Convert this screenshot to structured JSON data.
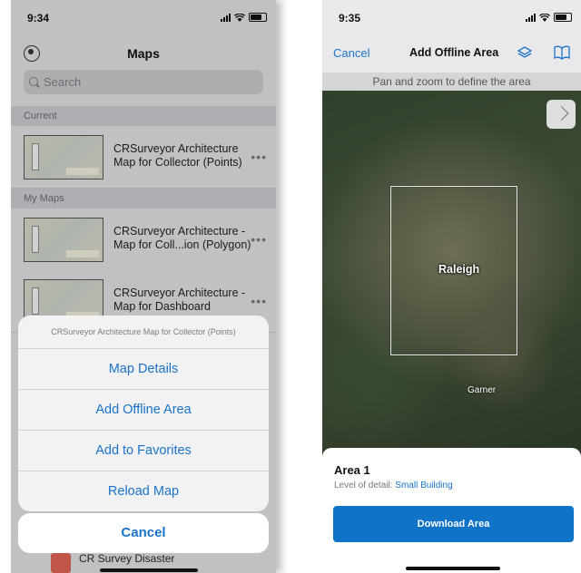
{
  "left": {
    "status": {
      "time": "9:34"
    },
    "title": "Maps",
    "search_placeholder": "Search",
    "sections": {
      "current": "Current",
      "my_maps": "My Maps"
    },
    "rows": [
      {
        "title": "CRSurveyor Architecture Map for Collector (Points)"
      },
      {
        "title": "CRSurveyor Architecture - Map for Coll...ion (Polygon)"
      },
      {
        "title": "CRSurveyor Architecture - Map for Dashboard"
      }
    ],
    "sheet": {
      "title": "CRSurveyor Architecture Map for Collector (Points)",
      "actions": [
        "Map Details",
        "Add Offline Area",
        "Add to Favorites",
        "Reload Map"
      ],
      "cancel": "Cancel"
    },
    "bottom_row": {
      "title": "CR Survey Disaster"
    }
  },
  "right": {
    "status": {
      "time": "9:35"
    },
    "nav": {
      "cancel": "Cancel",
      "title": "Add Offline Area"
    },
    "hint": "Pan and zoom to define the area",
    "map": {
      "city": "Raleigh",
      "town": "Garner"
    },
    "card": {
      "area_title": "Area 1",
      "detail_label": "Level of detail:",
      "detail_value": "Small Building",
      "button": "Download Area"
    }
  },
  "colors": {
    "accent": "#1a73c8",
    "button": "#0f73c7"
  }
}
